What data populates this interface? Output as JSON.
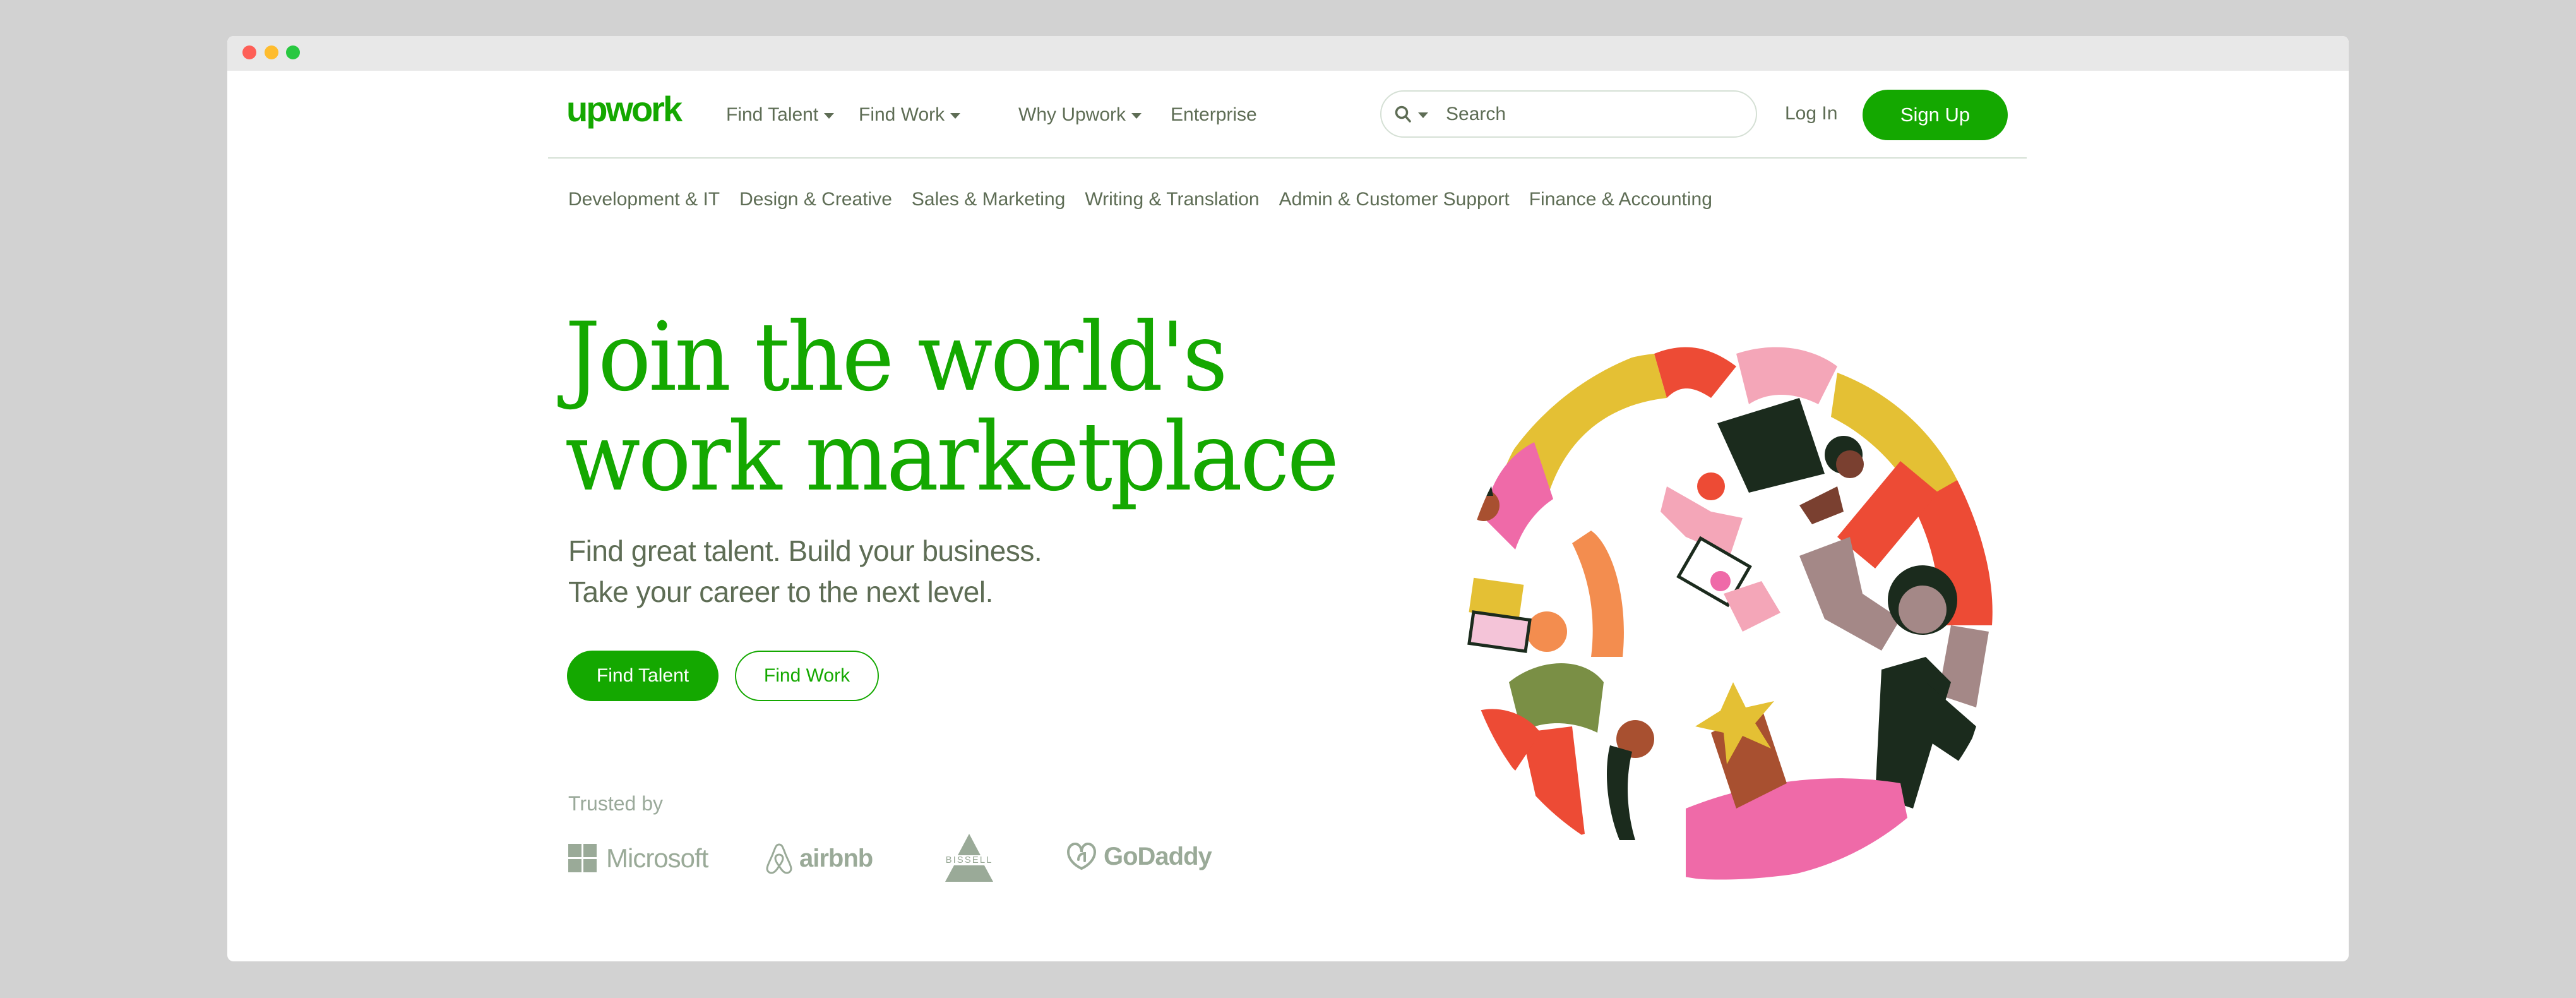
{
  "window": {
    "controls": [
      "close",
      "minimize",
      "maximize"
    ]
  },
  "header": {
    "logo_text": "upwork",
    "nav": [
      {
        "label": "Find Talent",
        "has_dropdown": true
      },
      {
        "label": "Find Work",
        "has_dropdown": true
      },
      {
        "label": "Why Upwork",
        "has_dropdown": true
      },
      {
        "label": "Enterprise",
        "has_dropdown": false
      }
    ],
    "search": {
      "placeholder": "Search",
      "value": "",
      "icon": "search-icon"
    },
    "login_label": "Log In",
    "signup_label": "Sign Up"
  },
  "categories": [
    "Development & IT",
    "Design & Creative",
    "Sales & Marketing",
    "Writing & Translation",
    "Admin & Customer Support",
    "Finance & Accounting"
  ],
  "hero": {
    "headline_line1": "Join the world's",
    "headline_line2": "work marketplace",
    "subhead_line1": "Find great talent. Build your business.",
    "subhead_line2": "Take your career to the next level.",
    "primary_cta": "Find Talent",
    "secondary_cta": "Find Work",
    "illustration": "people-collaborating-circle-illustration"
  },
  "trusted": {
    "label": "Trusted by",
    "brands": [
      "Microsoft",
      "airbnb",
      "BISSELL",
      "GoDaddy"
    ]
  },
  "colors": {
    "brand_green": "#14a800",
    "text_muted": "#5e6d55",
    "logo_gray": "#9aaa98",
    "divider": "#d5e0d5"
  }
}
